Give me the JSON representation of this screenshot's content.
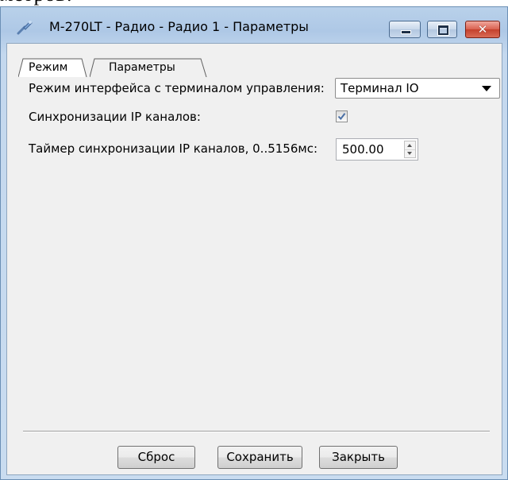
{
  "window": {
    "title": "М-270LT - Радио - Радио 1 - Параметры",
    "close_glyph": "✕"
  },
  "tabs": [
    {
      "label": "Режим",
      "active": true
    },
    {
      "label": "Параметры",
      "active": false
    }
  ],
  "form": {
    "interface_mode": {
      "label": "Режим интерфейса с терминалом управления:",
      "selected": "Терминал IO"
    },
    "ip_sync": {
      "label": "Синхронизации IP каналов:",
      "checked": true
    },
    "ip_sync_timer": {
      "label": "Таймер синхронизации IP каналов, 0..5156мс:",
      "value": "500.00"
    }
  },
  "buttons": {
    "reset": "Сброс",
    "save": "Сохранить",
    "close": "Закрыть"
  }
}
